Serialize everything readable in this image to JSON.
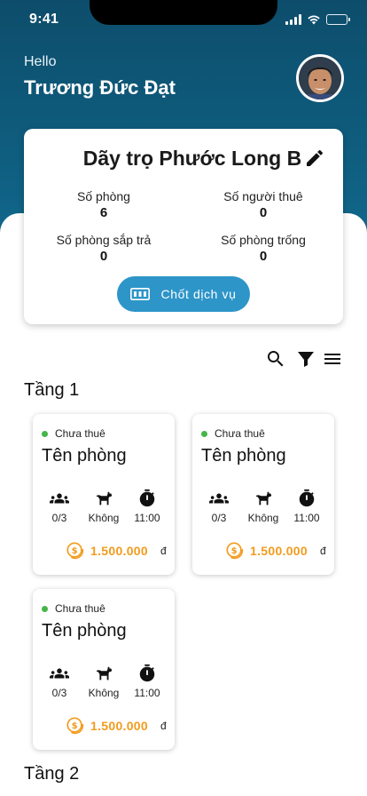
{
  "status_bar": {
    "time": "9:41"
  },
  "header": {
    "greeting": "Hello",
    "user_name": "Trương Đức Đạt"
  },
  "building": {
    "name": "Dãy trọ Phước Long B",
    "stats": [
      {
        "label": "Số phòng",
        "value": "6"
      },
      {
        "label": "Số người thuê",
        "value": "0"
      },
      {
        "label": "Số phòng sắp trả",
        "value": "0"
      },
      {
        "label": "Số phòng trống",
        "value": "0"
      }
    ],
    "service_button": "Chốt dịch vụ"
  },
  "floors": [
    {
      "title": "Tầng 1"
    },
    {
      "title": "Tầng 2"
    }
  ],
  "rooms": [
    {
      "status": "Chưa thuê",
      "name": "Tên phòng",
      "occupancy": "0/3",
      "pets": "Không",
      "time": "11:00",
      "price": "1.500.000",
      "currency": "đ"
    },
    {
      "status": "Chưa thuê",
      "name": "Tên phòng",
      "occupancy": "0/3",
      "pets": "Không",
      "time": "11:00",
      "price": "1.500.000",
      "currency": "đ"
    },
    {
      "status": "Chưa thuê",
      "name": "Tên phòng",
      "occupancy": "0/3",
      "pets": "Không",
      "time": "11:00",
      "price": "1.500.000",
      "currency": "đ"
    }
  ],
  "colors": {
    "header": "#0f5e80",
    "accent_button": "#2d95c8",
    "price": "#f29b1d",
    "status_available": "#45b649"
  }
}
